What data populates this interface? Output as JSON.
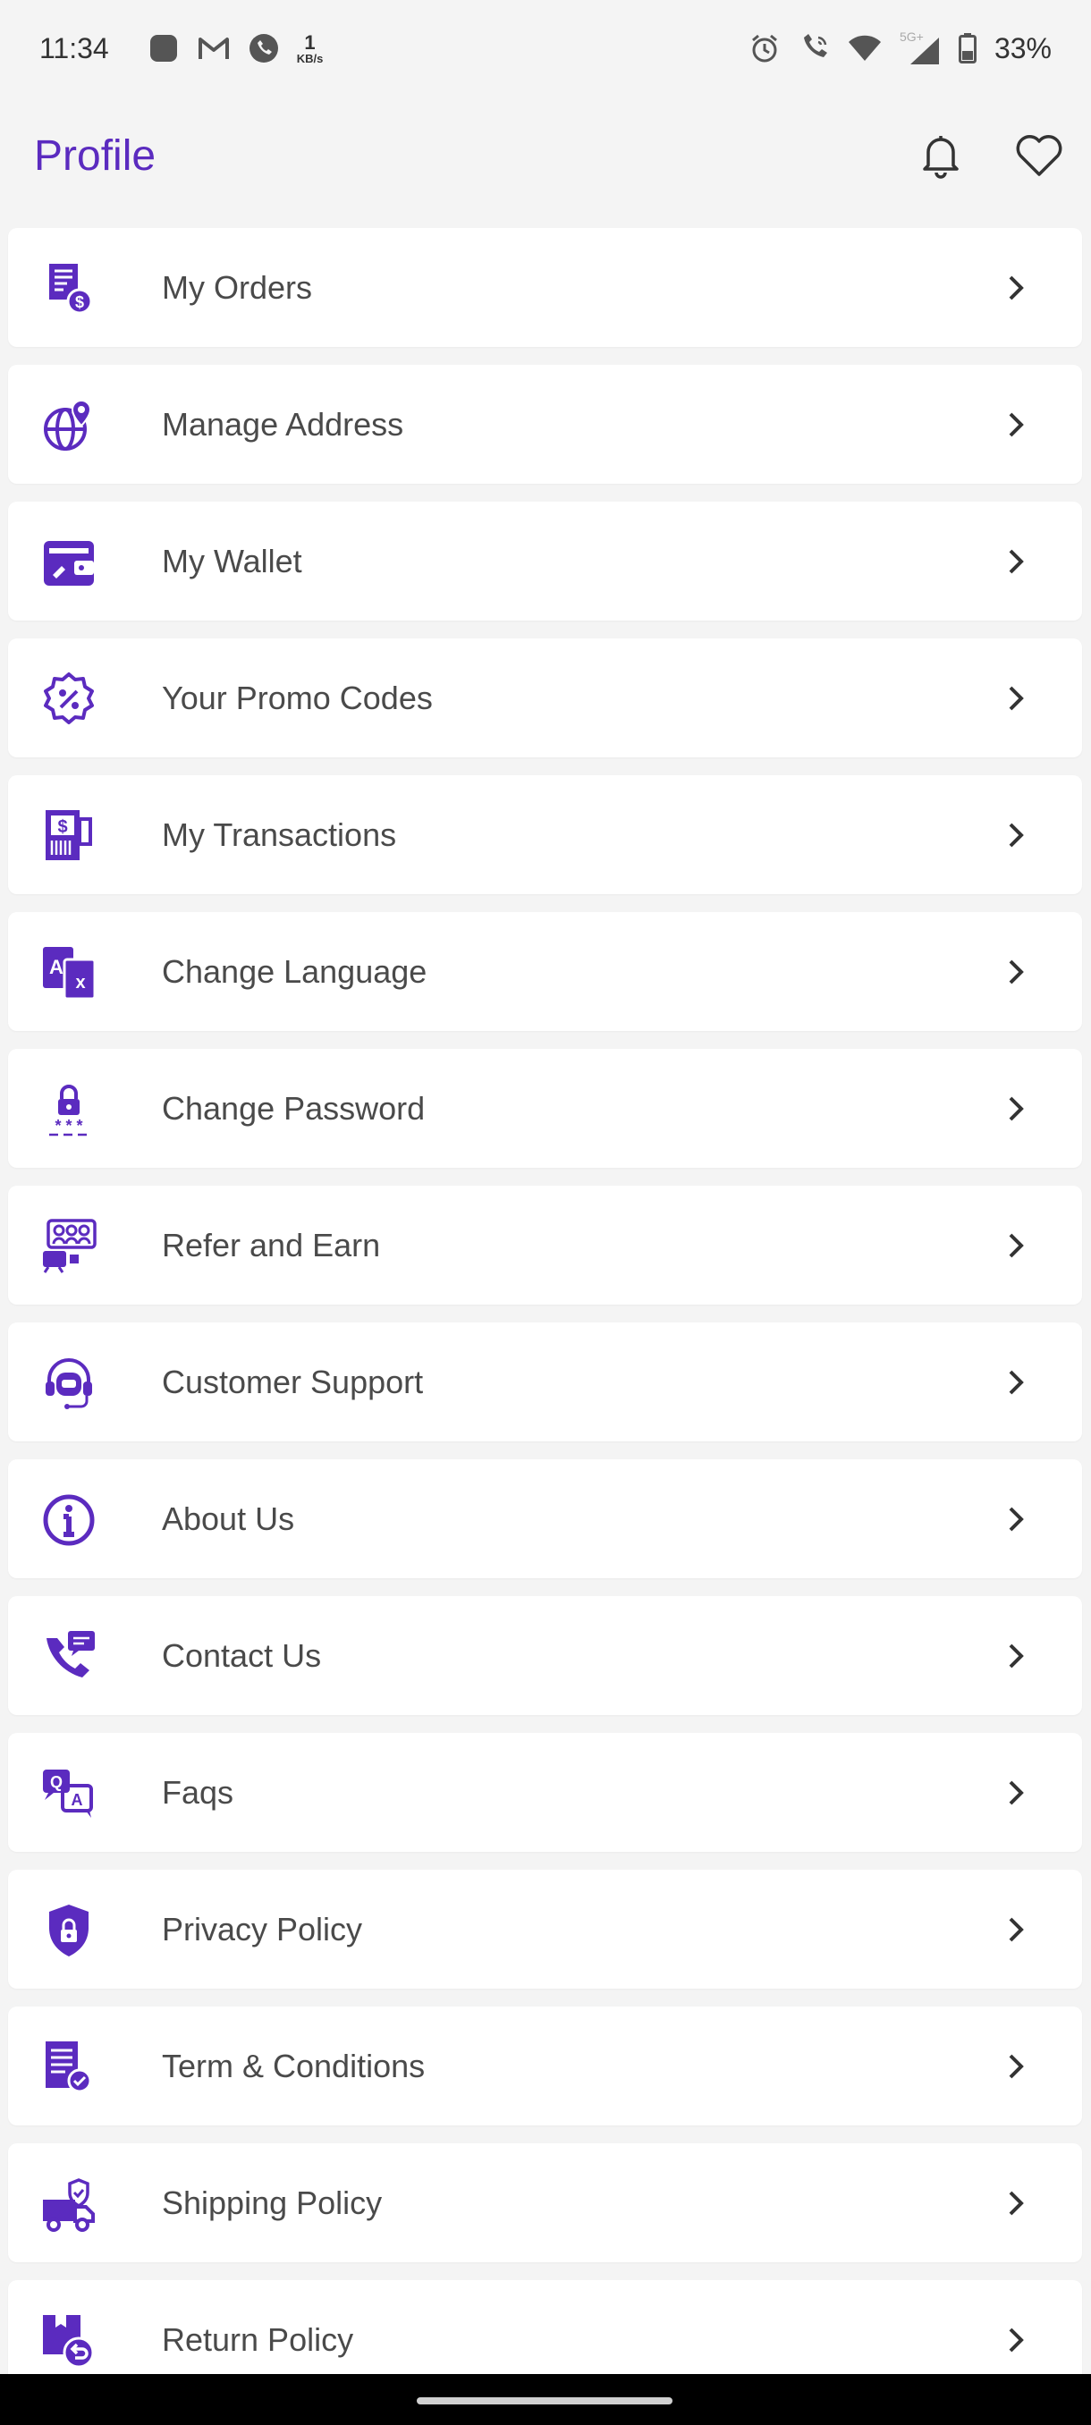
{
  "status_bar": {
    "time": "11:34",
    "net_speed_value": "1",
    "net_speed_unit": "KB/s",
    "network_label": "5G+",
    "battery": "33%"
  },
  "header": {
    "title": "Profile",
    "notification_icon": "bell-icon",
    "favorites_icon": "heart-icon"
  },
  "colors": {
    "accent": "#5b2bbf",
    "card": "#ffffff",
    "background": "#f4f4f4"
  },
  "menu": {
    "items": [
      {
        "label": "My Orders",
        "icon": "orders-receipt-icon"
      },
      {
        "label": "Manage Address",
        "icon": "globe-pin-icon"
      },
      {
        "label": "My Wallet",
        "icon": "wallet-icon"
      },
      {
        "label": "Your Promo Codes",
        "icon": "promo-badge-icon"
      },
      {
        "label": "My Transactions",
        "icon": "transactions-icon"
      },
      {
        "label": "Change Language",
        "icon": "language-icon"
      },
      {
        "label": "Change Password",
        "icon": "password-lock-icon"
      },
      {
        "label": "Refer and Earn",
        "icon": "refer-icon"
      },
      {
        "label": "Customer Support",
        "icon": "headset-icon"
      },
      {
        "label": "About Us",
        "icon": "info-icon"
      },
      {
        "label": "Contact Us",
        "icon": "phone-chat-icon"
      },
      {
        "label": "Faqs",
        "icon": "qa-icon"
      },
      {
        "label": "Privacy Policy",
        "icon": "shield-lock-icon"
      },
      {
        "label": "Term & Conditions",
        "icon": "document-check-icon"
      },
      {
        "label": "Shipping Policy",
        "icon": "truck-icon"
      },
      {
        "label": "Return Policy",
        "icon": "return-box-icon"
      }
    ]
  }
}
